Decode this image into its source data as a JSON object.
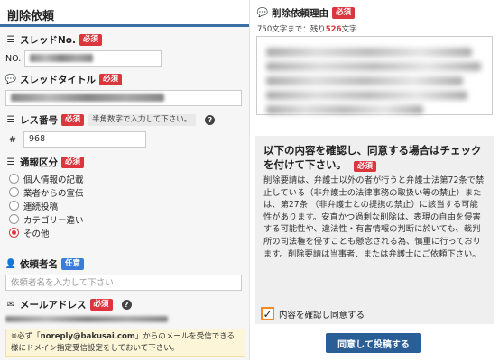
{
  "page_title": "削除依頼",
  "required_badge": "必須",
  "optional_badge": "任意",
  "thread_no": {
    "label": "スレッドNo.",
    "prefix": "NO."
  },
  "thread_title": {
    "label": "スレッドタイトル"
  },
  "res_number": {
    "label": "レス番号",
    "hint": "半角数字で入力して下さい。",
    "prefix": "#",
    "value": "968"
  },
  "report_type": {
    "label": "通報区分",
    "options": [
      "個人情報の記載",
      "業者からの宣伝",
      "連続投稿",
      "カテゴリー違い",
      "その他"
    ],
    "selected_index": 4
  },
  "requester_name": {
    "label": "依頼者名",
    "placeholder": "依頼者名を入力して下さい"
  },
  "email": {
    "label": "メールアドレス"
  },
  "notice": {
    "part1": "※必ず「",
    "email": "noreply@bakusai.com",
    "part2": "」からのメールを受信できる様にドメイン指定受信設定をしておいて下さい。"
  },
  "reason": {
    "label": "削除依頼理由",
    "counter_prefix": "750文字まで：残り",
    "counter_value": "526",
    "counter_suffix": "文字"
  },
  "consent": {
    "title": "以下の内容を確認し、同意する場合はチェックを付けて下さい。",
    "body": "削除要請は、弁護士以外の者が行うと弁護士法第72条で禁止している（非弁護士の法律事務の取扱い等の禁止）または、第27条 （非弁護士との提携の禁止）に該当する可能性があります。安直かつ過剰な削除は、表現の自由を侵害する可能性や、違法性・有害情報の判断に於いても、裁判所の司法権を侵すことも懸念される為、慎重に行っております。削除要請は当事者、または弁護士にご依頼下さい。",
    "checkbox_label": "内容を確認し同意する",
    "checked": true
  },
  "submit_label": "同意して投稿する"
}
